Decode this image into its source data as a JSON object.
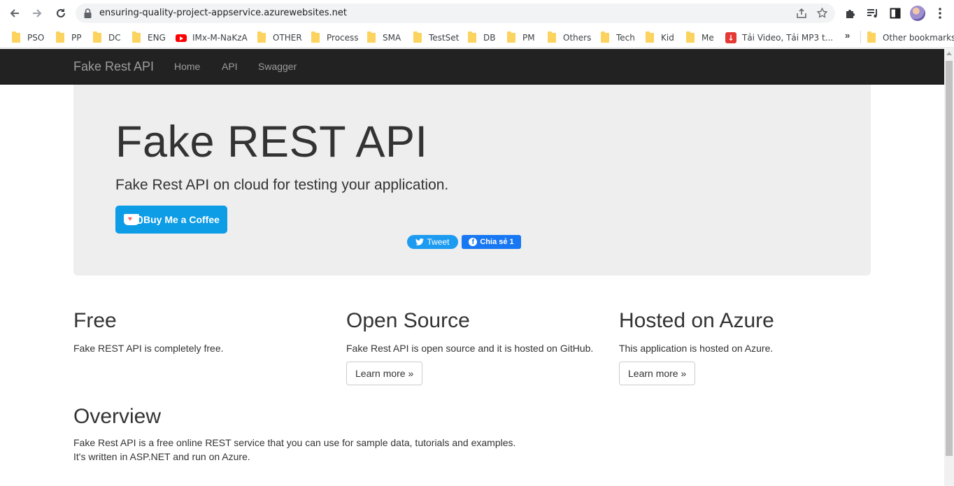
{
  "browser": {
    "url": "ensuring-quality-project-appservice.azurewebsites.net",
    "bookmarks": [
      {
        "label": "PSO",
        "type": "folder"
      },
      {
        "label": "PP",
        "type": "folder"
      },
      {
        "label": "DC",
        "type": "folder"
      },
      {
        "label": "ENG",
        "type": "folder"
      },
      {
        "label": "IMx-M-NaKzA",
        "type": "youtube"
      },
      {
        "label": "OTHER",
        "type": "folder"
      },
      {
        "label": "Process",
        "type": "folder"
      },
      {
        "label": "SMA",
        "type": "folder"
      },
      {
        "label": "TestSet",
        "type": "folder"
      },
      {
        "label": "DB",
        "type": "folder"
      },
      {
        "label": "PM",
        "type": "folder"
      },
      {
        "label": "Others",
        "type": "folder"
      },
      {
        "label": "Tech",
        "type": "folder"
      },
      {
        "label": "Kid",
        "type": "folder"
      },
      {
        "label": "Me",
        "type": "folder"
      },
      {
        "label": "Tải Video, Tải MP3 t...",
        "type": "download"
      }
    ],
    "overflow_label": "»",
    "other_bookmarks": "Other bookmarks"
  },
  "navbar": {
    "brand": "Fake Rest API",
    "links": [
      "Home",
      "API",
      "Swagger"
    ]
  },
  "jumbotron": {
    "title": "Fake REST API",
    "lead": "Fake Rest API on cloud for testing your application.",
    "coffee_button": "Buy Me a Coffee",
    "tweet_button": "Tweet",
    "share_button": "Chia sẻ 1"
  },
  "features": [
    {
      "title": "Free",
      "text": "Fake REST API is completely free.",
      "button": ""
    },
    {
      "title": "Open Source",
      "text": "Fake Rest API is open source and it is hosted on GitHub.",
      "button": "Learn more »"
    },
    {
      "title": "Hosted on Azure",
      "text": "This application is hosted on Azure.",
      "button": "Learn more »"
    }
  ],
  "overview": {
    "title": "Overview",
    "line1": "Fake Rest API is a free online REST service that you can use for sample data, tutorials and examples.",
    "line2": "It's written in ASP.NET and run on Azure."
  },
  "colors": {
    "navbar_bg": "#222222",
    "jumbotron_bg": "#eeeeee",
    "coffee_blue": "#0d9ce6",
    "twitter_blue": "#1d9bf0",
    "facebook_blue": "#1877f2"
  }
}
